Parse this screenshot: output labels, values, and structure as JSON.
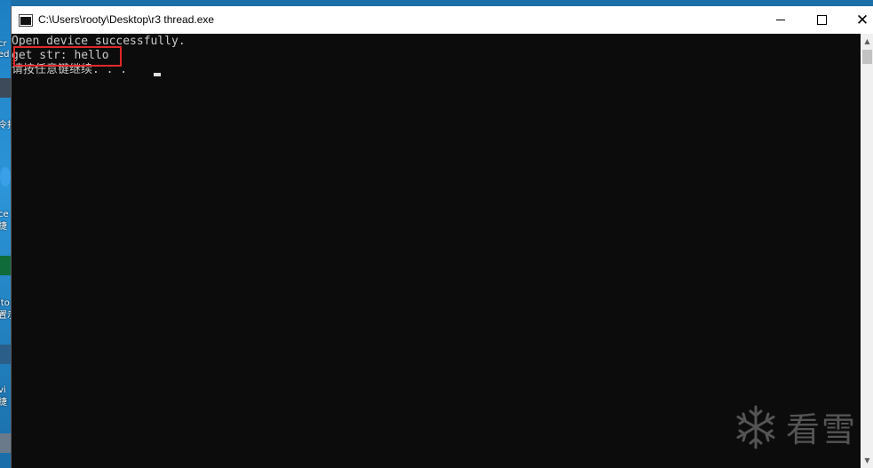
{
  "window": {
    "title": "C:\\Users\\rooty\\Desktop\\r3 thread.exe",
    "controls": {
      "minimize": "",
      "maximize": "",
      "close": "✕"
    }
  },
  "console": {
    "lines": [
      "Open device successfully.",
      "get str: hello",
      "请按任意键继续. . ."
    ]
  },
  "scrollbar": {
    "up_arrow": "▲",
    "down_arrow": "▼"
  },
  "watermark": {
    "text": "看雪"
  },
  "desktop": {
    "labels": [
      "cr",
      "ed",
      "令找",
      "ce",
      "捷",
      "ito",
      "置示",
      "vi",
      "捷"
    ]
  },
  "colors": {
    "console_bg": "#0c0c0c",
    "console_text": "#c8c8c8",
    "highlight": "#e02828",
    "desktop_bg": "#1b6fa8"
  }
}
